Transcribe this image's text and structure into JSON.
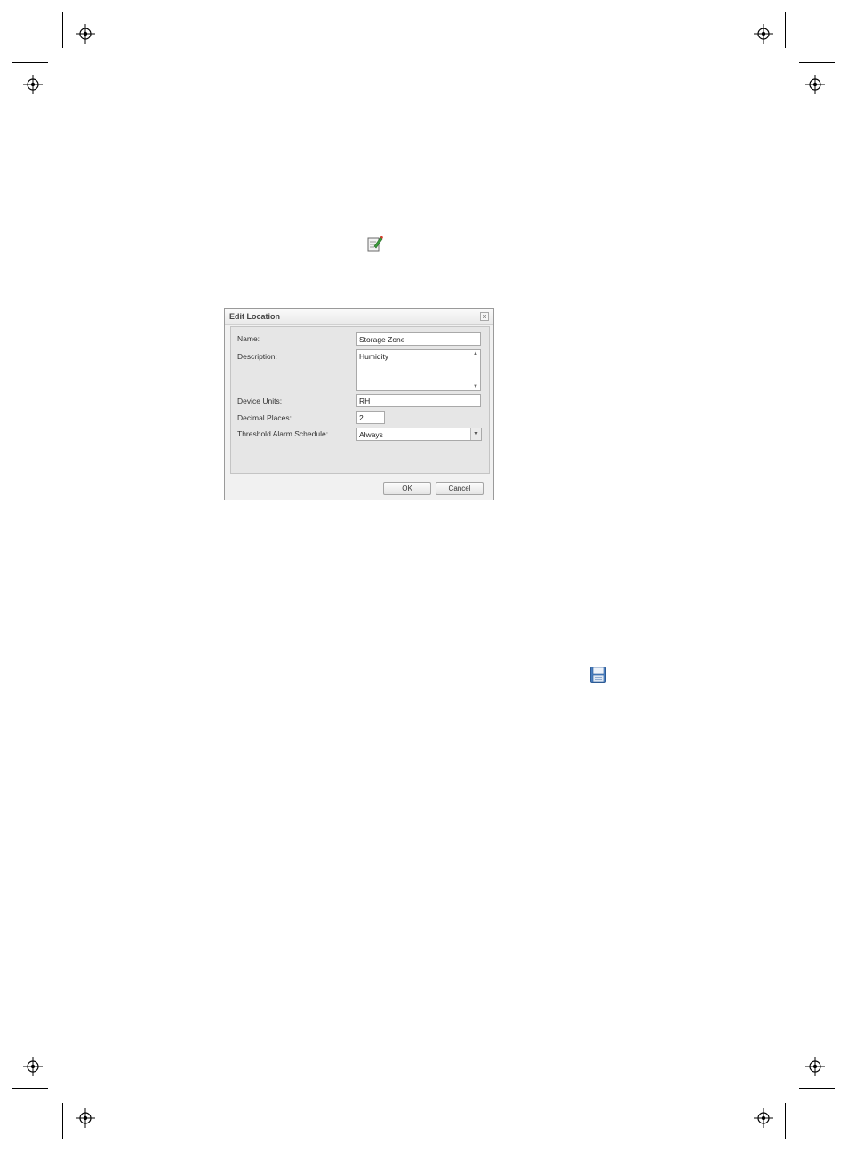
{
  "dialog": {
    "title": "Edit Location",
    "close_glyph": "×",
    "fields": {
      "name": {
        "label": "Name:",
        "value": "Storage Zone"
      },
      "description": {
        "label": "Description:",
        "value": "Humidity"
      },
      "device_units": {
        "label": "Device Units:",
        "value": "RH"
      },
      "decimal_places": {
        "label": "Decimal Places:",
        "value": "2"
      },
      "threshold_alarm_schedule": {
        "label": "Threshold Alarm Schedule:",
        "value": "Always"
      }
    },
    "buttons": {
      "ok": "OK",
      "cancel": "Cancel"
    }
  },
  "icons": {
    "edit": "edit-pencil-icon",
    "save": "save-floppy-icon",
    "close": "close-icon",
    "registration": "registration-mark-icon"
  },
  "colors": {
    "dialog_bg": "#f1f1f1",
    "dialog_body": "#e6e6e6",
    "save_icon_blue": "#4a7fc1"
  }
}
